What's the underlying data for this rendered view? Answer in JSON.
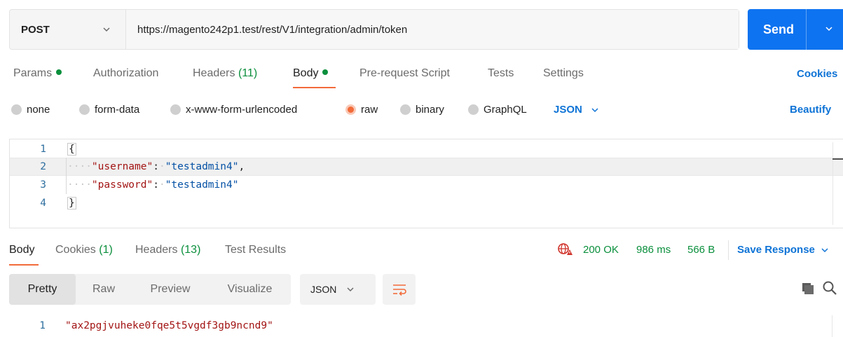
{
  "request": {
    "method": "POST",
    "url": "https://magento242p1.test/rest/V1/integration/admin/token",
    "send_label": "Send"
  },
  "request_tabs": [
    {
      "label": "Params",
      "count": "",
      "dot": true,
      "active": false
    },
    {
      "label": "Authorization",
      "count": "",
      "dot": false,
      "active": false
    },
    {
      "label": "Headers",
      "count": "(11)",
      "dot": false,
      "active": false
    },
    {
      "label": "Body",
      "count": "",
      "dot": true,
      "active": true
    },
    {
      "label": "Pre-request Script",
      "count": "",
      "dot": false,
      "active": false
    },
    {
      "label": "Tests",
      "count": "",
      "dot": false,
      "active": false
    },
    {
      "label": "Settings",
      "count": "",
      "dot": false,
      "active": false
    }
  ],
  "cookies_link": "Cookies",
  "body_types": [
    {
      "label": "none",
      "selected": false
    },
    {
      "label": "form-data",
      "selected": false
    },
    {
      "label": "x-www-form-urlencoded",
      "selected": false
    },
    {
      "label": "raw",
      "selected": true
    },
    {
      "label": "binary",
      "selected": false
    },
    {
      "label": "GraphQL",
      "selected": false
    }
  ],
  "raw_format": "JSON",
  "beautify_label": "Beautify",
  "request_body": {
    "line_numbers": [
      "1",
      "2",
      "3",
      "4"
    ],
    "open_brace": "{",
    "close_brace": "}",
    "fields": [
      {
        "key": "\"username\"",
        "value": "\"testadmin4\"",
        "trailing": ","
      },
      {
        "key": "\"password\"",
        "value": "\"testadmin4\"",
        "trailing": ""
      }
    ]
  },
  "response_tabs": [
    {
      "label": "Body",
      "count": "",
      "active": true
    },
    {
      "label": "Cookies",
      "count": "(1)",
      "active": false
    },
    {
      "label": "Headers",
      "count": "(13)",
      "active": false
    },
    {
      "label": "Test Results",
      "count": "",
      "active": false
    }
  ],
  "response_status": {
    "status": "200 OK",
    "time": "986 ms",
    "size": "566 B"
  },
  "save_response_label": "Save Response",
  "view_modes": [
    "Pretty",
    "Raw",
    "Preview",
    "Visualize"
  ],
  "active_view_mode": "Pretty",
  "response_format": "JSON",
  "response_body": {
    "line_number": "1",
    "value": "\"ax2pgjvuheke0fqe5t5vgdf3gb9ncnd9\""
  },
  "colors": {
    "accent": "#f26b3a",
    "send_blue": "#0e73f0",
    "link_blue": "#0e73d6",
    "status_green": "#0a8f3c"
  },
  "icons": [
    "chevron-down-icon",
    "globe-icon",
    "wrap-lines-icon",
    "copy-icon",
    "search-icon"
  ]
}
